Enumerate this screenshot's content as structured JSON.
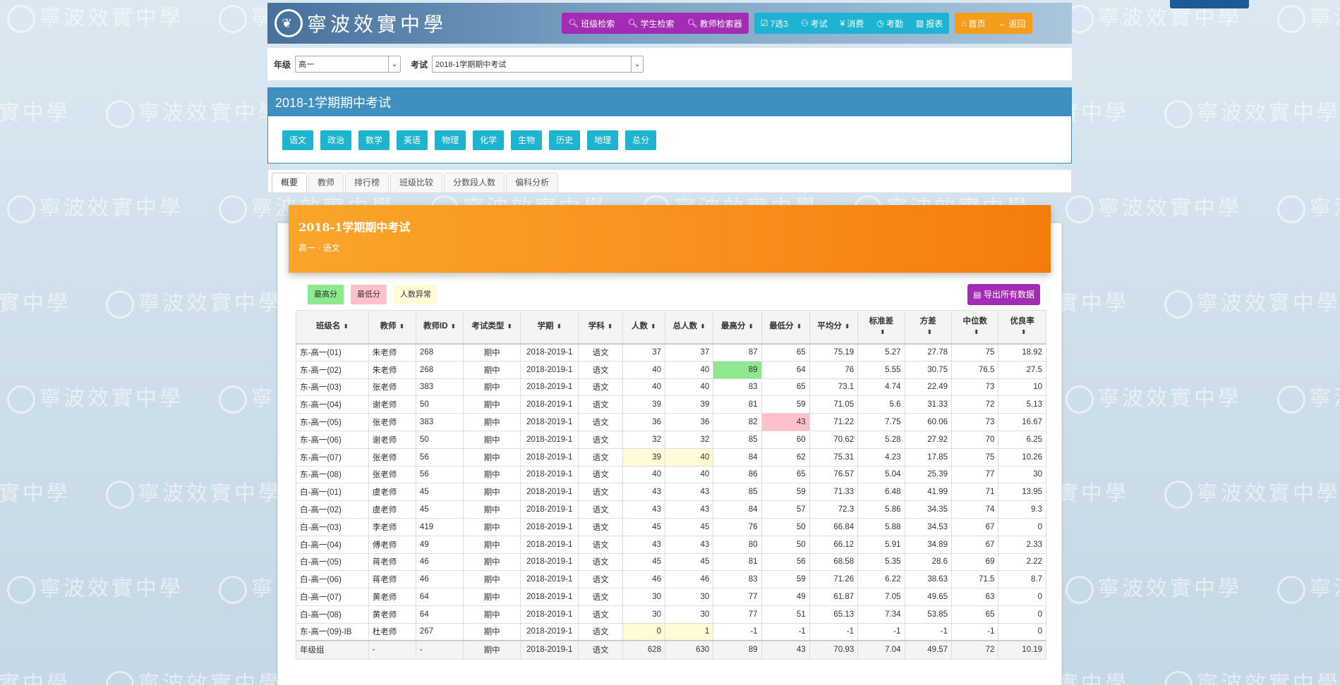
{
  "logo": {
    "text": "寧波效實中學"
  },
  "nav": {
    "search": [
      {
        "label": "班级检索",
        "icon": "search-icon"
      },
      {
        "label": "学生检索",
        "icon": "search-icon"
      },
      {
        "label": "教师检索器",
        "icon": "search-icon"
      }
    ],
    "tools": [
      {
        "label": "7选3",
        "icon": "checkbox-icon"
      },
      {
        "label": "考试",
        "icon": "user-icon"
      },
      {
        "label": "消费",
        "icon": "yen-icon"
      },
      {
        "label": "考勤",
        "icon": "clock-icon"
      },
      {
        "label": "报表",
        "icon": "chart-icon"
      }
    ],
    "home": [
      {
        "label": "首页",
        "icon": "home-icon"
      },
      {
        "label": "返回",
        "icon": "arrow-left-icon"
      }
    ]
  },
  "filter": {
    "grade_label": "年级",
    "grade_value": "高一",
    "exam_label": "考试",
    "exam_value": "2018-1学期期中考试"
  },
  "exam_panel": {
    "title": "2018-1学期期中考试",
    "subjects": [
      "语文",
      "政治",
      "数学",
      "英语",
      "物理",
      "化学",
      "生物",
      "历史",
      "地理",
      "总分"
    ]
  },
  "tabs": [
    "概要",
    "教师",
    "排行榜",
    "班级比较",
    "分数段人数",
    "偏科分析"
  ],
  "banner": {
    "title": "2018-1学期期中考试",
    "subtitle": "高一 · 语文"
  },
  "legend": {
    "max": "最高分",
    "min": "最低分",
    "count": "人数异常"
  },
  "export_label": "导出所有数据",
  "table": {
    "headers": [
      "班级名",
      "教师",
      "教师ID",
      "考试类型",
      "学期",
      "学科",
      "人数",
      "总人数",
      "最高分",
      "最低分",
      "平均分",
      "标准差",
      "方差",
      "中位数",
      "优良率"
    ],
    "rows": [
      [
        "东-高一(01)",
        "朱老师",
        "268",
        "期中",
        "2018-2019-1",
        "语文",
        "37",
        "37",
        "87",
        "65",
        "75.19",
        "5.27",
        "27.78",
        "75",
        "18.92"
      ],
      [
        "东-高一(02)",
        "朱老师",
        "268",
        "期中",
        "2018-2019-1",
        "语文",
        "40",
        "40",
        "89",
        "64",
        "76",
        "5.55",
        "30.75",
        "76.5",
        "27.5"
      ],
      [
        "东-高一(03)",
        "张老师",
        "383",
        "期中",
        "2018-2019-1",
        "语文",
        "40",
        "40",
        "83",
        "65",
        "73.1",
        "4.74",
        "22.49",
        "73",
        "10"
      ],
      [
        "东-高一(04)",
        "谢老师",
        "50",
        "期中",
        "2018-2019-1",
        "语文",
        "39",
        "39",
        "81",
        "59",
        "71.05",
        "5.6",
        "31.33",
        "72",
        "5.13"
      ],
      [
        "东-高一(05)",
        "张老师",
        "383",
        "期中",
        "2018-2019-1",
        "语文",
        "36",
        "36",
        "82",
        "43",
        "71.22",
        "7.75",
        "60.06",
        "73",
        "16.67"
      ],
      [
        "东-高一(06)",
        "谢老师",
        "50",
        "期中",
        "2018-2019-1",
        "语文",
        "32",
        "32",
        "85",
        "60",
        "70.62",
        "5.28",
        "27.92",
        "70",
        "6.25"
      ],
      [
        "东-高一(07)",
        "张老师",
        "56",
        "期中",
        "2018-2019-1",
        "语文",
        "39",
        "40",
        "84",
        "62",
        "75.31",
        "4.23",
        "17.85",
        "75",
        "10.26"
      ],
      [
        "东-高一(08)",
        "张老师",
        "56",
        "期中",
        "2018-2019-1",
        "语文",
        "40",
        "40",
        "86",
        "65",
        "76.57",
        "5.04",
        "25.39",
        "77",
        "30"
      ],
      [
        "白-高一(01)",
        "虞老师",
        "45",
        "期中",
        "2018-2019-1",
        "语文",
        "43",
        "43",
        "85",
        "59",
        "71.33",
        "6.48",
        "41.99",
        "71",
        "13.95"
      ],
      [
        "白-高一(02)",
        "虞老师",
        "45",
        "期中",
        "2018-2019-1",
        "语文",
        "43",
        "43",
        "84",
        "57",
        "72.3",
        "5.86",
        "34.35",
        "74",
        "9.3"
      ],
      [
        "白-高一(03)",
        "李老师",
        "419",
        "期中",
        "2018-2019-1",
        "语文",
        "45",
        "45",
        "76",
        "50",
        "66.84",
        "5.88",
        "34.53",
        "67",
        "0"
      ],
      [
        "白-高一(04)",
        "傅老师",
        "49",
        "期中",
        "2018-2019-1",
        "语文",
        "43",
        "43",
        "80",
        "50",
        "66.12",
        "5.91",
        "34.89",
        "67",
        "2.33"
      ],
      [
        "白-高一(05)",
        "蒋老师",
        "46",
        "期中",
        "2018-2019-1",
        "语文",
        "45",
        "45",
        "81",
        "56",
        "68.58",
        "5.35",
        "28.6",
        "69",
        "2.22"
      ],
      [
        "白-高一(06)",
        "蒋老师",
        "46",
        "期中",
        "2018-2019-1",
        "语文",
        "46",
        "46",
        "83",
        "59",
        "71.26",
        "6.22",
        "38.63",
        "71.5",
        "8.7"
      ],
      [
        "白-高一(07)",
        "黄老师",
        "64",
        "期中",
        "2018-2019-1",
        "语文",
        "30",
        "30",
        "77",
        "49",
        "61.87",
        "7.05",
        "49.65",
        "63",
        "0"
      ],
      [
        "白-高一(08)",
        "黄老师",
        "64",
        "期中",
        "2018-2019-1",
        "语文",
        "30",
        "30",
        "77",
        "51",
        "65.13",
        "7.34",
        "53.85",
        "65",
        "0"
      ],
      [
        "东-高一(09)-IB",
        "杜老师",
        "267",
        "期中",
        "2018-2019-1",
        "语文",
        "0",
        "1",
        "-1",
        "-1",
        "-1",
        "-1",
        "-1",
        "-1",
        "0"
      ]
    ],
    "total": [
      "年级组",
      "-",
      "-",
      "期中",
      "2018-2019-1",
      "语文",
      "628",
      "630",
      "89",
      "43",
      "70.93",
      "7.04",
      "49.57",
      "72",
      "10.19"
    ],
    "highlights": {
      "max_row": 1,
      "min_row": 4,
      "count_rows": [
        6,
        16
      ]
    }
  },
  "colors": {
    "header_blue": "#3f8fc1",
    "purple": "#a42bb3",
    "cyan": "#1fb3d3",
    "orange": "#f59d1a",
    "banner_orange": "#f8901d"
  }
}
